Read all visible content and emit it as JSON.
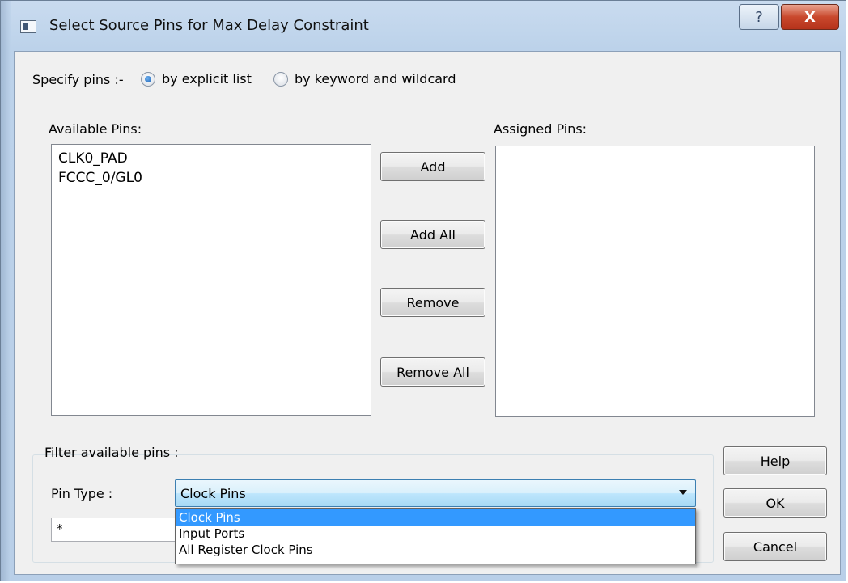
{
  "window": {
    "title": "Select Source Pins for Max Delay Constraint",
    "help_glyph": "?",
    "close_glyph": "X"
  },
  "specify": {
    "label": "Specify pins :-",
    "options": [
      {
        "label": "by explicit list",
        "checked": true
      },
      {
        "label": "by keyword and wildcard",
        "checked": false
      }
    ]
  },
  "available": {
    "label": "Available Pins:",
    "items": [
      "CLK0_PAD",
      "FCCC_0/GL0"
    ]
  },
  "assigned": {
    "label": "Assigned Pins:",
    "items": []
  },
  "transfer_buttons": {
    "add": "Add",
    "add_all": "Add All",
    "remove": "Remove",
    "remove_all": "Remove All"
  },
  "filter": {
    "group_label": "Filter available pins :",
    "pin_type_label": "Pin Type :",
    "pin_type_value": "Clock Pins",
    "pattern_value": "*",
    "dropdown_options": [
      "Clock Pins",
      "Input Ports",
      "All Register Clock Pins"
    ],
    "selected_option": "Clock Pins"
  },
  "dialog_buttons": {
    "help": "Help",
    "ok": "OK",
    "cancel": "Cancel"
  },
  "colors": {
    "selection": "#3399ff",
    "close_button": "#c9482d",
    "title_bar": "#bcd2ea"
  }
}
